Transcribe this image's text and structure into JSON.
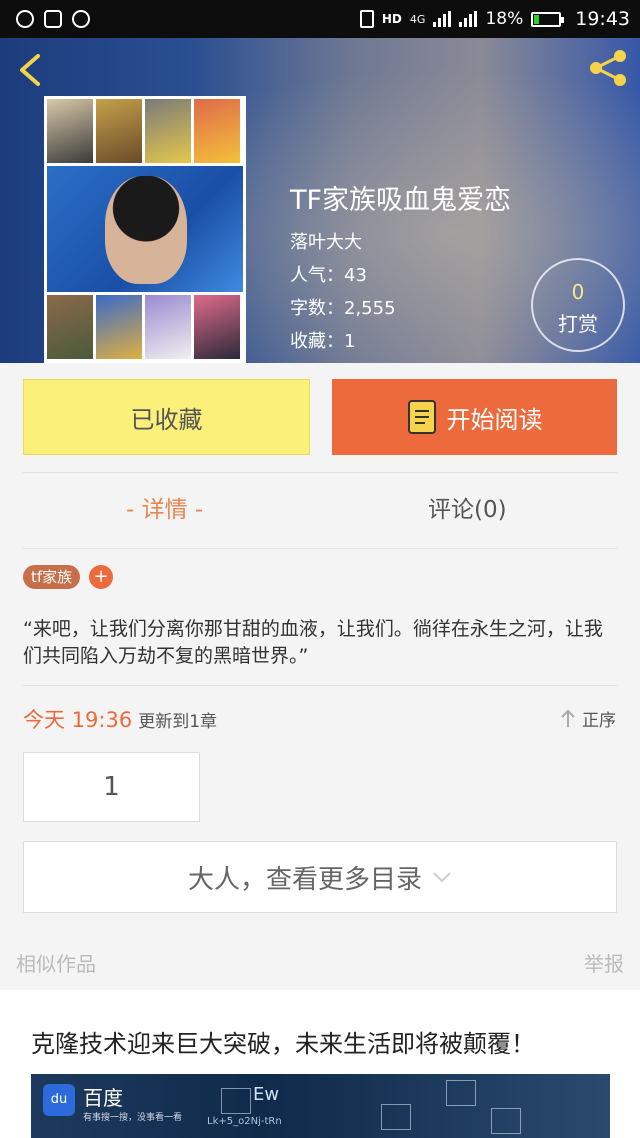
{
  "status_bar": {
    "network": "4G",
    "battery": "18%",
    "battery_level": 0.18,
    "time": "19:43"
  },
  "book": {
    "title": "TF家族吸血鬼爱恋",
    "author": "落叶大大",
    "popularity": "人气：43",
    "word_count": "字数：2,555",
    "favorites": "收藏：1"
  },
  "reward": {
    "count": "0",
    "label": "打赏"
  },
  "actions": {
    "favorite_label": "已收藏",
    "read_label": "开始阅读"
  },
  "tabs": {
    "detail": "- 详情 -",
    "comments": "评论(0)"
  },
  "tags": [
    "tf家族"
  ],
  "tag_add": "+",
  "description": "“来吧，让我们分离你那甘甜的血液，让我们。徜徉在永生之河，让我们共同陷入万劫不复的黑暗世界。”",
  "update": {
    "time": "今天 19:36",
    "text": "更新到1章",
    "order": "正序"
  },
  "chapters": [
    "1"
  ],
  "more_catalog": "大人，查看更多目录",
  "similar_works": "相似作品",
  "report": "举报",
  "ad": {
    "title": "克隆技术迎来巨大突破，未来生活即将被颠覆！",
    "brand": "百度",
    "slogan": "有事搜一搜，没事看一看",
    "logo_text": "du",
    "tech_text": "Ew",
    "tech_text2": "Lk+5_o2Nj-tRn"
  },
  "colors": {
    "accent": "#ec6a3c",
    "favorite_bg": "#fbf17a",
    "tag_bg": "#c66f4a"
  }
}
